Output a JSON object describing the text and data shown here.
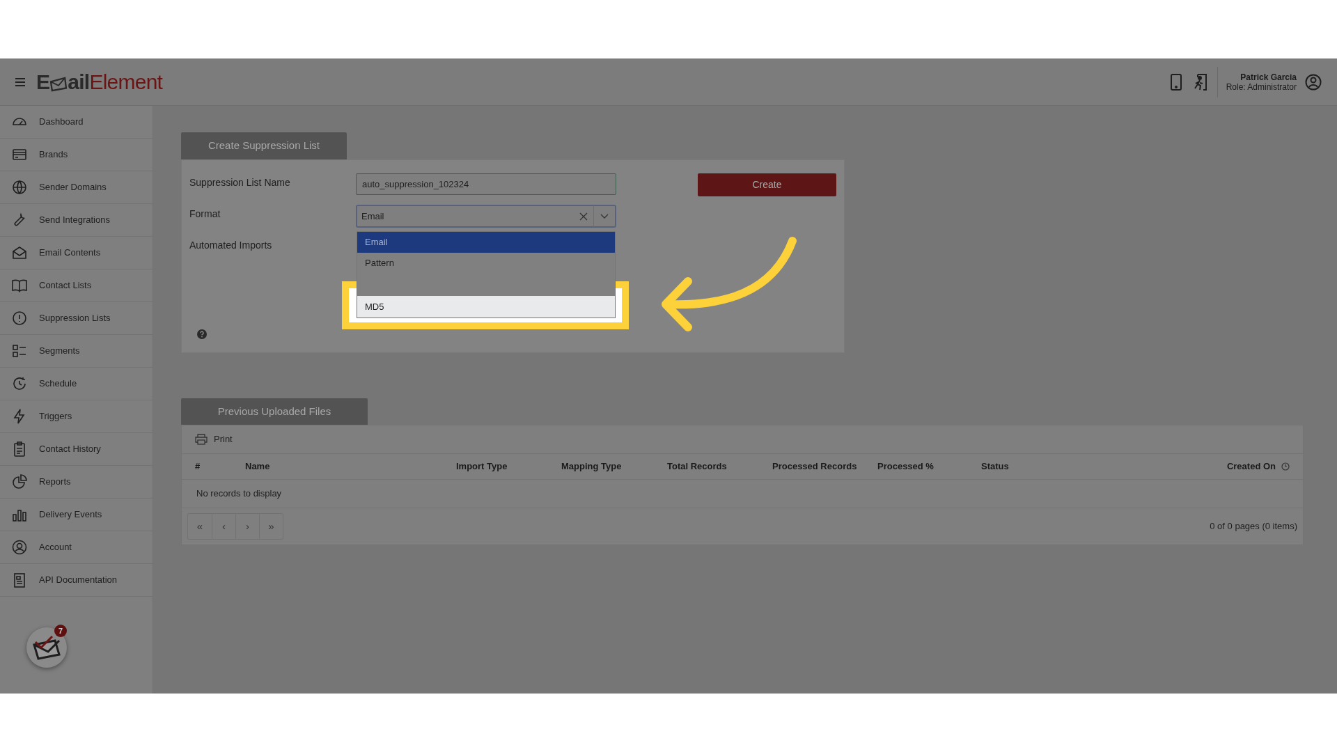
{
  "header": {
    "logo": {
      "first": "E",
      "rest": "ail",
      "accent": "Element"
    },
    "user_name": "Patrick Garcia",
    "user_role": "Role: Administrator"
  },
  "sidebar": {
    "items": [
      {
        "label": "Dashboard"
      },
      {
        "label": "Brands"
      },
      {
        "label": "Sender Domains"
      },
      {
        "label": "Send Integrations"
      },
      {
        "label": "Email Contents"
      },
      {
        "label": "Contact Lists"
      },
      {
        "label": "Suppression Lists"
      },
      {
        "label": "Segments"
      },
      {
        "label": "Schedule"
      },
      {
        "label": "Triggers"
      },
      {
        "label": "Contact History"
      },
      {
        "label": "Reports"
      },
      {
        "label": "Delivery Events"
      },
      {
        "label": "Account"
      },
      {
        "label": "API Documentation"
      }
    ],
    "notification_count": "7"
  },
  "form": {
    "tab": "Create Suppression List",
    "create_button": "Create",
    "fields": [
      {
        "label": "Suppression List Name",
        "kind": "text",
        "value": "auto_suppression_102324"
      },
      {
        "label": "Format",
        "kind": "select",
        "value": "Email",
        "options": [
          {
            "kind": "option",
            "label": "Email",
            "selected": true
          },
          {
            "kind": "option",
            "label": "Pattern",
            "selected": false
          },
          {
            "kind": "covered"
          },
          {
            "kind": "highlighted",
            "label": "MD5",
            "selected": false
          }
        ]
      },
      {
        "label": "Automated Imports",
        "kind": "plain"
      }
    ]
  },
  "uploads": {
    "tab": "Previous Uploaded Files",
    "print_button": "Print",
    "columns": [
      "#",
      "Name",
      "Import Type",
      "Mapping Type",
      "Total Records",
      "Processed Records",
      "Processed %",
      "Status",
      "Created On"
    ],
    "empty_message": "No records to display",
    "pager": [
      "«",
      "‹",
      "›",
      "»"
    ],
    "page_info": "0 of 0 pages (0 items)"
  }
}
